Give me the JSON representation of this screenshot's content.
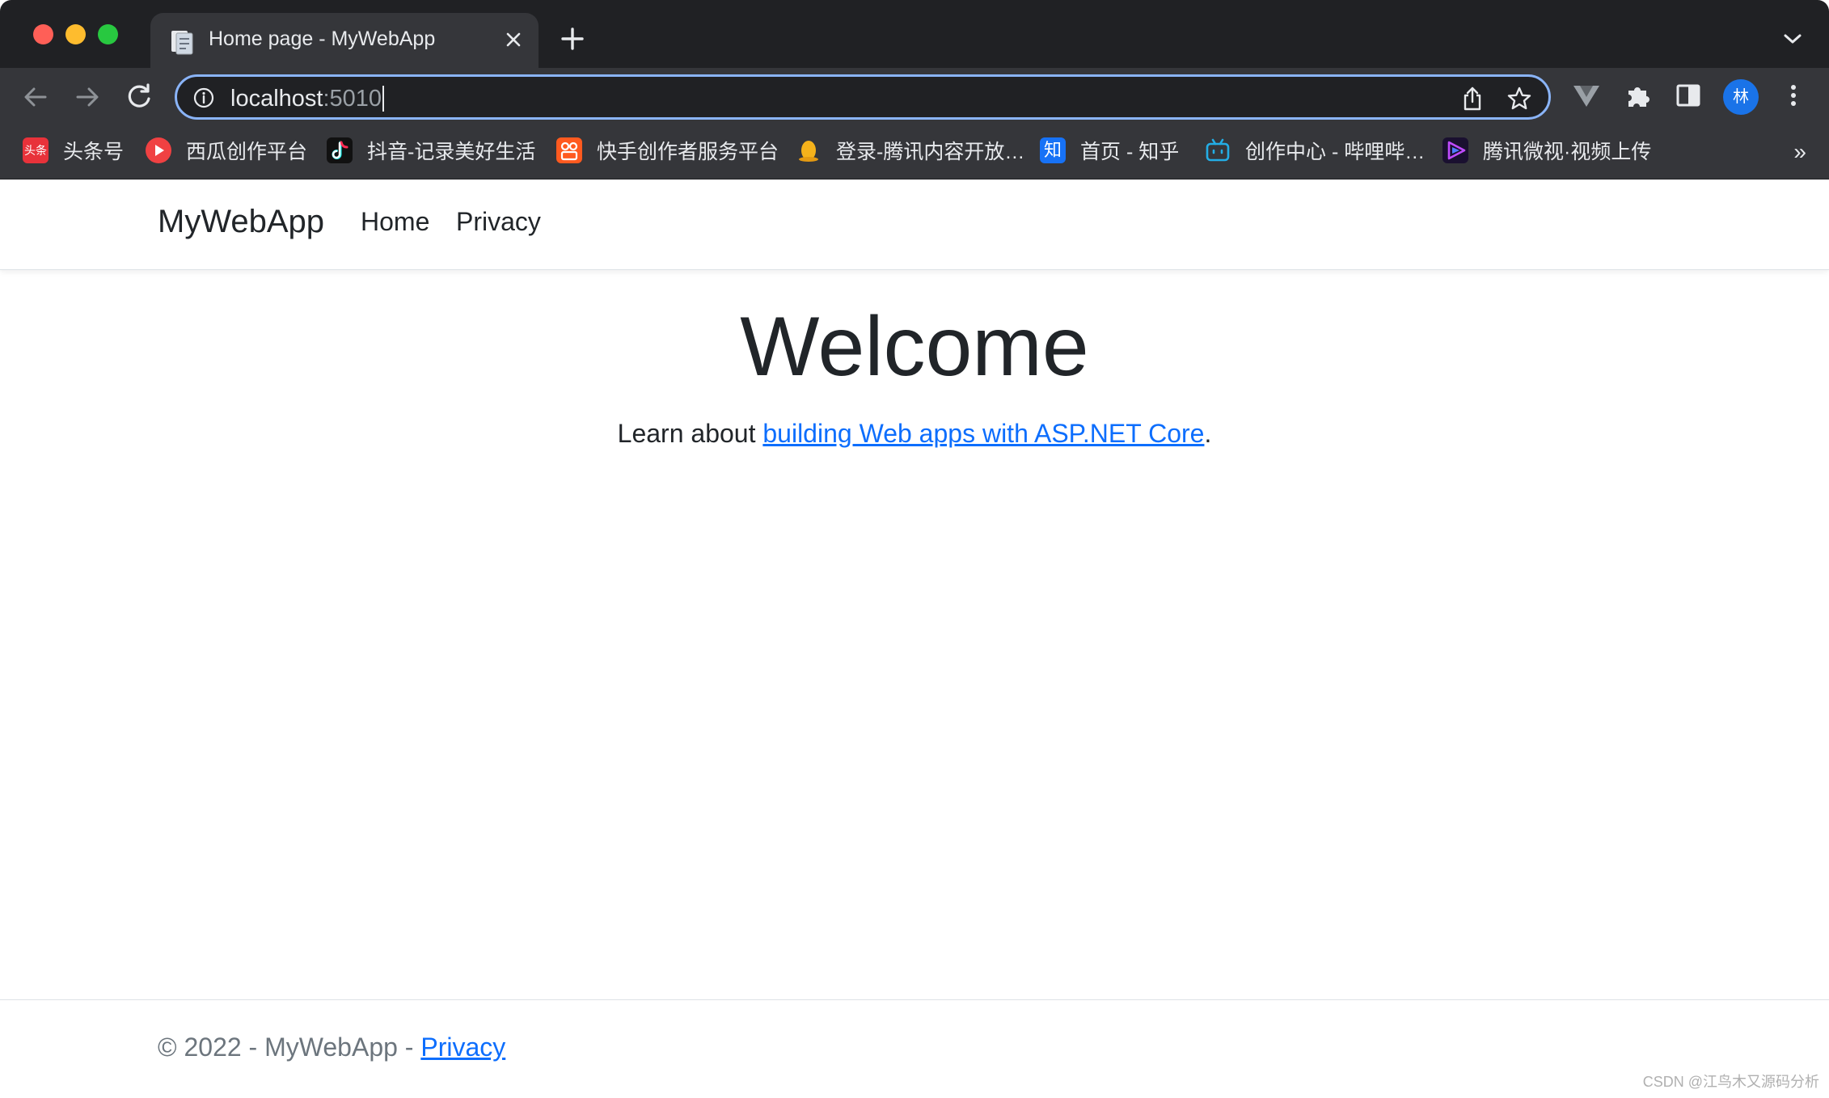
{
  "browser": {
    "tab": {
      "title": "Home page - MyWebApp",
      "favicon": "document-icon"
    },
    "address_bar": {
      "host": "localhost",
      "port": ":5010"
    },
    "profile_initial": "林",
    "bookmarks": [
      {
        "label": "头条号",
        "icon": "toutiao-icon",
        "color": "#e8323a"
      },
      {
        "label": "西瓜创作平台",
        "icon": "xigua-icon",
        "color": "#f04142"
      },
      {
        "label": "抖音-记录美好生活",
        "icon": "douyin-icon",
        "color": "#111111"
      },
      {
        "label": "快手创作者服务平台",
        "icon": "kuaishou-icon",
        "color": "#ff5a1f"
      },
      {
        "label": "登录-腾讯内容开放…",
        "icon": "qq-penguin-icon",
        "color": "#f5b21b"
      },
      {
        "label": "首页 - 知乎",
        "icon": "zhihu-icon",
        "color": "#1772f6"
      },
      {
        "label": "创作中心 - 哔哩哔…",
        "icon": "bilibili-icon",
        "color": "#23ade5"
      },
      {
        "label": "腾讯微视·视频上传",
        "icon": "weishi-icon",
        "color": "#7b2ff7"
      }
    ],
    "overflow_label": "»"
  },
  "site": {
    "brand": "MyWebApp",
    "nav": {
      "home": "Home",
      "privacy": "Privacy"
    },
    "heading": "Welcome",
    "learn_prefix": "Learn about ",
    "learn_link": "building Web apps with ASP.NET Core",
    "learn_suffix": ".",
    "footer_prefix": "© 2022 - MyWebApp - ",
    "footer_link": "Privacy",
    "watermark": "CSDN @江鸟木又源码分析"
  },
  "colors": {
    "link": "#0d6efd",
    "omnibox_focus": "#8ab4f8",
    "chrome_dark": "#202124",
    "chrome_toolbar": "#35363a"
  }
}
